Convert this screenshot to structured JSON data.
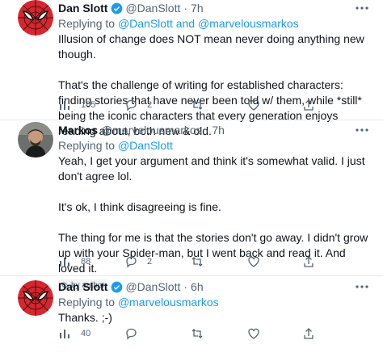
{
  "tweets": [
    {
      "name": "Dan Slott",
      "handle": "@DanSlott",
      "time": "7h",
      "replying_prefix": "Replying to",
      "replying_to": "@DanSlott and @marvelousmarkos",
      "body": "Illusion of change does NOT mean never doing anything new though.\n\nThat's the challenge of writing for established characters: finding stories that have never been told w/ them, while *still* being the iconic characters that every generation enjoys reading about, both new & old.",
      "likes_count": "105",
      "replies_count": "2"
    },
    {
      "name": "Markos",
      "handle": "@marvelousmarkos",
      "time": "7h",
      "replying_prefix": "Replying to",
      "replying_to": "@DanSlott",
      "body": "Yeah, I get your argument and think it's somewhat valid. I just don't agree lol.\n\nIt's ok, I think disagreeing is fine.\n\nThe thing for me is that the stories don't go away. I didn't grow up with your Spider-man, but I went back and read it. And loved it.",
      "author_tag": "by author",
      "likes_count": "88",
      "replies_count": "2"
    },
    {
      "name": "Dan Slott",
      "handle": "@DanSlott",
      "time": "6h",
      "replying_prefix": "Replying to",
      "replying_to": "@marvelousmarkos",
      "body": "Thanks. ;-)",
      "likes_count": "40"
    }
  ],
  "separator": "·",
  "colors": {
    "link": "#1d9bf0",
    "muted": "#536471",
    "verified": "#1d9bf0"
  },
  "icons": [
    "spiderman-avatar",
    "verified-badge-icon",
    "more-icon",
    "likes-icon",
    "reply-icon",
    "retweet-icon",
    "heart-icon",
    "share-icon"
  ]
}
